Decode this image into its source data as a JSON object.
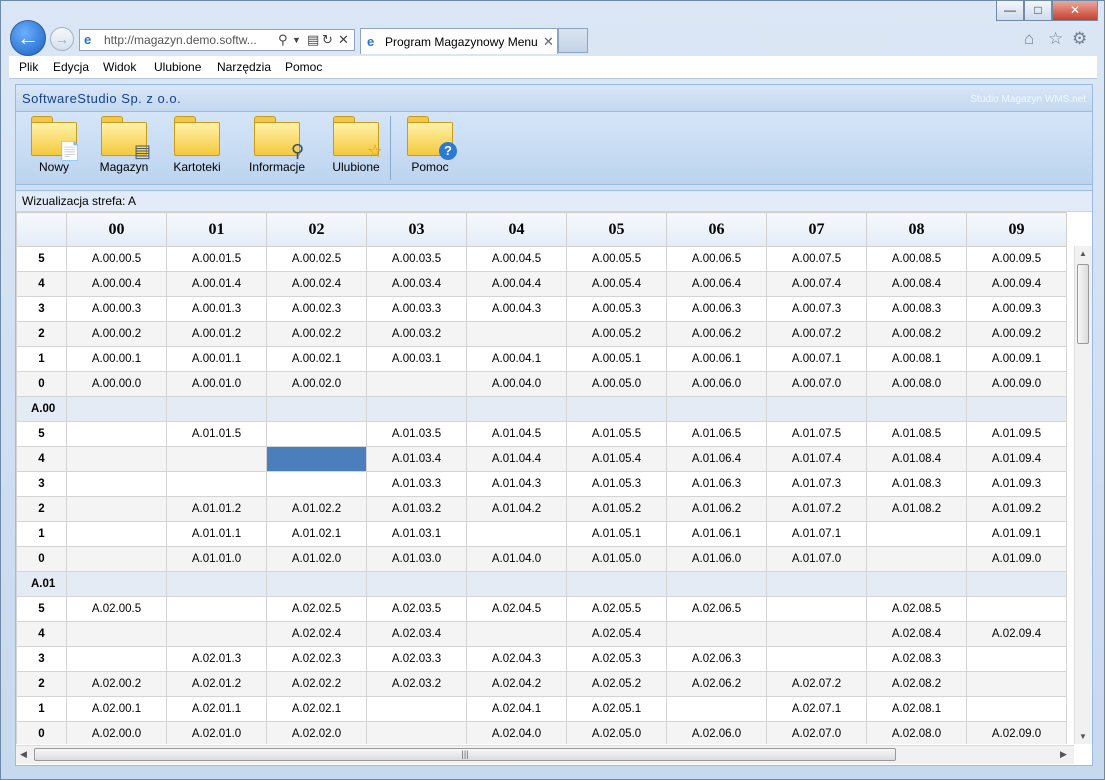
{
  "browser": {
    "url": "http://magazyn.demo.softw...",
    "tab_title": "Program Magazynowy Menu",
    "window_controls": {
      "minimize": "—",
      "maximize": "□",
      "close": "✕"
    }
  },
  "menu": [
    "Plik",
    "Edycja",
    "Widok",
    "Ulubione",
    "Narzędzia",
    "Pomoc"
  ],
  "app": {
    "title": "SoftwareStudio Sp. z o.o.",
    "subtitle": "Studio Magazyn WMS.net",
    "toolbar": [
      {
        "label": "Nowy",
        "icon": "new-document-folder-icon"
      },
      {
        "label": "Magazyn",
        "icon": "database-folder-icon"
      },
      {
        "label": "Kartoteki",
        "icon": "folder-icon"
      },
      {
        "label": "Informacje",
        "icon": "search-folder-icon"
      },
      {
        "label": "Ulubione",
        "icon": "star-folder-icon"
      },
      {
        "label": "Pomoc",
        "icon": "help-folder-icon"
      }
    ],
    "panel_title": "Wizualizacja strefa: A"
  },
  "grid": {
    "columns": [
      "00",
      "01",
      "02",
      "03",
      "04",
      "05",
      "06",
      "07",
      "08",
      "09"
    ],
    "rows": [
      {
        "label": "5",
        "cells": [
          "A.00.00.5",
          "A.00.01.5",
          "A.00.02.5",
          "A.00.03.5",
          "A.00.04.5",
          "A.00.05.5",
          "A.00.06.5",
          "A.00.07.5",
          "A.00.08.5",
          "A.00.09.5"
        ]
      },
      {
        "label": "4",
        "cells": [
          "A.00.00.4",
          "A.00.01.4",
          "A.00.02.4",
          "A.00.03.4",
          "A.00.04.4",
          "A.00.05.4",
          "A.00.06.4",
          "A.00.07.4",
          "A.00.08.4",
          "A.00.09.4"
        ]
      },
      {
        "label": "3",
        "cells": [
          "A.00.00.3",
          "A.00.01.3",
          "A.00.02.3",
          "A.00.03.3",
          "A.00.04.3",
          "A.00.05.3",
          "A.00.06.3",
          "A.00.07.3",
          "A.00.08.3",
          "A.00.09.3"
        ]
      },
      {
        "label": "2",
        "cells": [
          "A.00.00.2",
          "A.00.01.2",
          "A.00.02.2",
          "A.00.03.2",
          "",
          "A.00.05.2",
          "A.00.06.2",
          "A.00.07.2",
          "A.00.08.2",
          "A.00.09.2"
        ]
      },
      {
        "label": "1",
        "cells": [
          "A.00.00.1",
          "A.00.01.1",
          "A.00.02.1",
          "A.00.03.1",
          "A.00.04.1",
          "A.00.05.1",
          "A.00.06.1",
          "A.00.07.1",
          "A.00.08.1",
          "A.00.09.1"
        ]
      },
      {
        "label": "0",
        "cells": [
          "A.00.00.0",
          "A.00.01.0",
          "A.00.02.0",
          "",
          "A.00.04.0",
          "A.00.05.0",
          "A.00.06.0",
          "A.00.07.0",
          "A.00.08.0",
          "A.00.09.0"
        ]
      },
      {
        "label": "A.00",
        "section": true
      },
      {
        "label": "5",
        "cells": [
          "",
          "A.01.01.5",
          "",
          "A.01.03.5",
          "A.01.04.5",
          "A.01.05.5",
          "A.01.06.5",
          "A.01.07.5",
          "A.01.08.5",
          "A.01.09.5"
        ]
      },
      {
        "label": "4",
        "cells": [
          "",
          "",
          "",
          "A.01.03.4",
          "A.01.04.4",
          "A.01.05.4",
          "A.01.06.4",
          "A.01.07.4",
          "A.01.08.4",
          "A.01.09.4"
        ],
        "selected": 2
      },
      {
        "label": "3",
        "cells": [
          "",
          "",
          "",
          "A.01.03.3",
          "A.01.04.3",
          "A.01.05.3",
          "A.01.06.3",
          "A.01.07.3",
          "A.01.08.3",
          "A.01.09.3"
        ]
      },
      {
        "label": "2",
        "cells": [
          "",
          "A.01.01.2",
          "A.01.02.2",
          "A.01.03.2",
          "A.01.04.2",
          "A.01.05.2",
          "A.01.06.2",
          "A.01.07.2",
          "A.01.08.2",
          "A.01.09.2"
        ]
      },
      {
        "label": "1",
        "cells": [
          "",
          "A.01.01.1",
          "A.01.02.1",
          "A.01.03.1",
          "",
          "A.01.05.1",
          "A.01.06.1",
          "A.01.07.1",
          "",
          "A.01.09.1"
        ]
      },
      {
        "label": "0",
        "cells": [
          "",
          "A.01.01.0",
          "A.01.02.0",
          "A.01.03.0",
          "A.01.04.0",
          "A.01.05.0",
          "A.01.06.0",
          "A.01.07.0",
          "",
          "A.01.09.0"
        ]
      },
      {
        "label": "A.01",
        "section": true
      },
      {
        "label": "5",
        "cells": [
          "A.02.00.5",
          "",
          "A.02.02.5",
          "A.02.03.5",
          "A.02.04.5",
          "A.02.05.5",
          "A.02.06.5",
          "",
          "A.02.08.5",
          ""
        ]
      },
      {
        "label": "4",
        "cells": [
          "",
          "",
          "A.02.02.4",
          "A.02.03.4",
          "",
          "A.02.05.4",
          "",
          "",
          "A.02.08.4",
          "A.02.09.4"
        ]
      },
      {
        "label": "3",
        "cells": [
          "",
          "A.02.01.3",
          "A.02.02.3",
          "A.02.03.3",
          "A.02.04.3",
          "A.02.05.3",
          "A.02.06.3",
          "",
          "A.02.08.3",
          ""
        ]
      },
      {
        "label": "2",
        "cells": [
          "A.02.00.2",
          "A.02.01.2",
          "A.02.02.2",
          "A.02.03.2",
          "A.02.04.2",
          "A.02.05.2",
          "A.02.06.2",
          "A.02.07.2",
          "A.02.08.2",
          ""
        ]
      },
      {
        "label": "1",
        "cells": [
          "A.02.00.1",
          "A.02.01.1",
          "A.02.02.1",
          "",
          "A.02.04.1",
          "A.02.05.1",
          "",
          "A.02.07.1",
          "A.02.08.1",
          ""
        ]
      },
      {
        "label": "0",
        "cells": [
          "A.02.00.0",
          "A.02.01.0",
          "A.02.02.0",
          "",
          "A.02.04.0",
          "A.02.05.0",
          "A.02.06.0",
          "A.02.07.0",
          "A.02.08.0",
          "A.02.09.0"
        ]
      }
    ]
  },
  "colors": {
    "selected_cell": "#4a7fbb",
    "header_text": "#15428b"
  }
}
